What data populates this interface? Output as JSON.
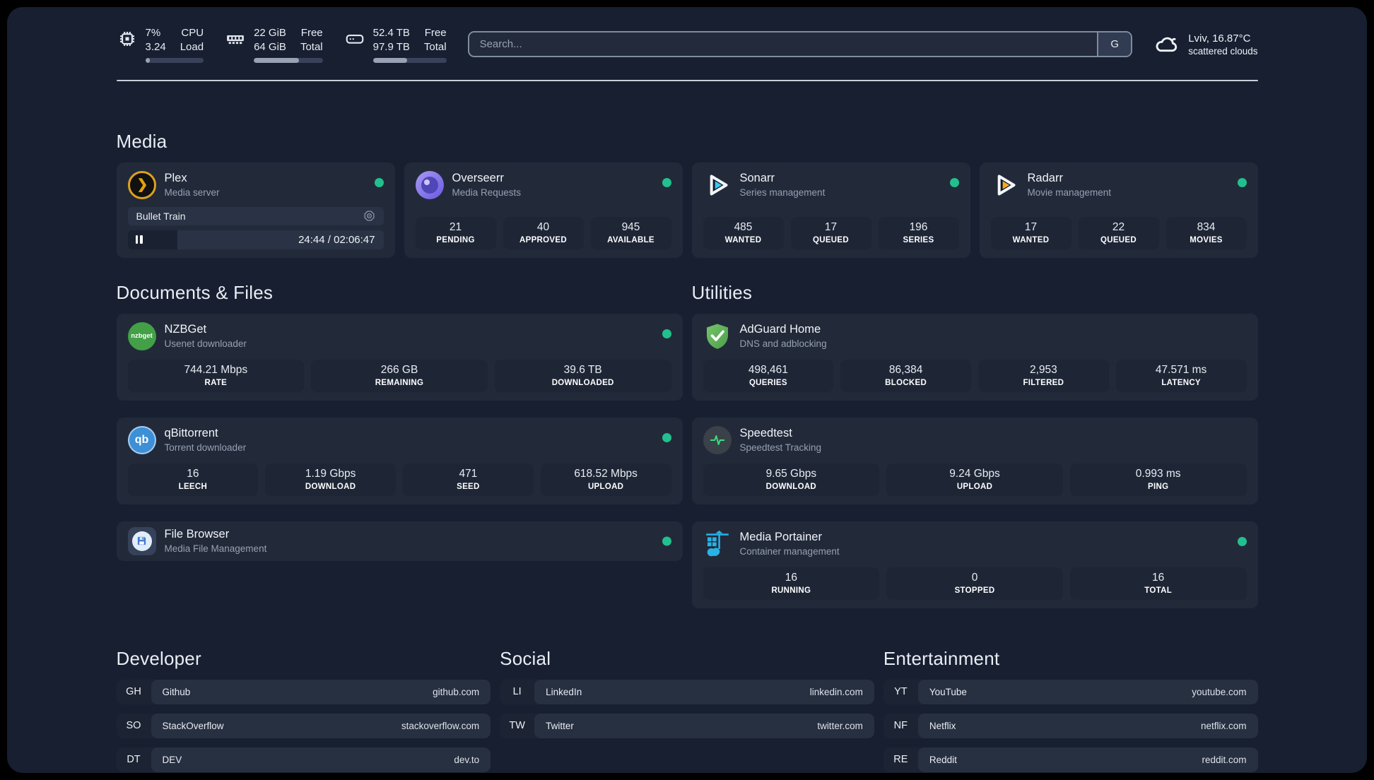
{
  "topbar": {
    "system": [
      {
        "kind": "cpu",
        "values": [
          "7%",
          "3.24"
        ],
        "labels": [
          "CPU",
          "Load"
        ],
        "progress": 8
      },
      {
        "kind": "memory",
        "values": [
          "22 GiB",
          "64 GiB"
        ],
        "labels": [
          "Free",
          "Total"
        ],
        "progress": 66
      },
      {
        "kind": "disk",
        "values": [
          "52.4 TB",
          "97.9 TB"
        ],
        "labels": [
          "Free",
          "Total"
        ],
        "progress": 47
      }
    ],
    "search": {
      "placeholder": "Search...",
      "engine_label": "G"
    },
    "weather": {
      "location_temp": "Lviv, 16.87°C",
      "condition": "scattered clouds"
    }
  },
  "media": {
    "title": "Media",
    "plex": {
      "title": "Plex",
      "subtitle": "Media server",
      "now_playing": "Bullet Train",
      "time": "24:44 / 02:06:47",
      "progress_percent": 19.5
    },
    "cards": [
      {
        "title": "Overseerr",
        "subtitle": "Media Requests",
        "stats": [
          {
            "value": "21",
            "label": "PENDING"
          },
          {
            "value": "40",
            "label": "APPROVED"
          },
          {
            "value": "945",
            "label": "AVAILABLE"
          }
        ]
      },
      {
        "title": "Sonarr",
        "subtitle": "Series management",
        "stats": [
          {
            "value": "485",
            "label": "WANTED"
          },
          {
            "value": "17",
            "label": "QUEUED"
          },
          {
            "value": "196",
            "label": "SERIES"
          }
        ]
      },
      {
        "title": "Radarr",
        "subtitle": "Movie management",
        "stats": [
          {
            "value": "17",
            "label": "WANTED"
          },
          {
            "value": "22",
            "label": "QUEUED"
          },
          {
            "value": "834",
            "label": "MOVIES"
          }
        ]
      }
    ]
  },
  "documents": {
    "title": "Documents & Files",
    "cards": [
      {
        "title": "NZBGet",
        "subtitle": "Usenet downloader",
        "badge_text": "nzbget",
        "stats": [
          {
            "value": "744.21 Mbps",
            "label": "RATE"
          },
          {
            "value": "266 GB",
            "label": "REMAINING"
          },
          {
            "value": "39.6 TB",
            "label": "DOWNLOADED"
          }
        ]
      },
      {
        "title": "qBittorrent",
        "subtitle": "Torrent downloader",
        "badge_text": "qb",
        "stats": [
          {
            "value": "16",
            "label": "LEECH"
          },
          {
            "value": "1.19 Gbps",
            "label": "DOWNLOAD"
          },
          {
            "value": "471",
            "label": "SEED"
          },
          {
            "value": "618.52 Mbps",
            "label": "UPLOAD"
          }
        ]
      },
      {
        "title": "File Browser",
        "subtitle": "Media File Management",
        "stats": []
      }
    ]
  },
  "utilities": {
    "title": "Utilities",
    "cards": [
      {
        "title": "AdGuard Home",
        "subtitle": "DNS and adblocking",
        "stats": [
          {
            "value": "498,461",
            "label": "QUERIES"
          },
          {
            "value": "86,384",
            "label": "BLOCKED"
          },
          {
            "value": "2,953",
            "label": "FILTERED"
          },
          {
            "value": "47.571 ms",
            "label": "LATENCY"
          }
        ]
      },
      {
        "title": "Speedtest",
        "subtitle": "Speedtest Tracking",
        "stats": [
          {
            "value": "9.65 Gbps",
            "label": "DOWNLOAD"
          },
          {
            "value": "9.24 Gbps",
            "label": "UPLOAD"
          },
          {
            "value": "0.993 ms",
            "label": "PING"
          }
        ]
      },
      {
        "title": "Media Portainer",
        "subtitle": "Container management",
        "stats": [
          {
            "value": "16",
            "label": "RUNNING"
          },
          {
            "value": "0",
            "label": "STOPPED"
          },
          {
            "value": "16",
            "label": "TOTAL"
          }
        ]
      }
    ]
  },
  "links": {
    "developer": {
      "title": "Developer",
      "items": [
        {
          "badge": "GH",
          "name": "Github",
          "domain": "github.com"
        },
        {
          "badge": "SO",
          "name": "StackOverflow",
          "domain": "stackoverflow.com"
        },
        {
          "badge": "DT",
          "name": "DEV",
          "domain": "dev.to"
        }
      ]
    },
    "social": {
      "title": "Social",
      "items": [
        {
          "badge": "LI",
          "name": "LinkedIn",
          "domain": "linkedin.com"
        },
        {
          "badge": "TW",
          "name": "Twitter",
          "domain": "twitter.com"
        }
      ]
    },
    "entertainment": {
      "title": "Entertainment",
      "items": [
        {
          "badge": "YT",
          "name": "YouTube",
          "domain": "youtube.com"
        },
        {
          "badge": "NF",
          "name": "Netflix",
          "domain": "netflix.com"
        },
        {
          "badge": "RE",
          "name": "Reddit",
          "domain": "reddit.com"
        }
      ]
    }
  },
  "colors": {
    "status_ok": "#22c08e"
  }
}
